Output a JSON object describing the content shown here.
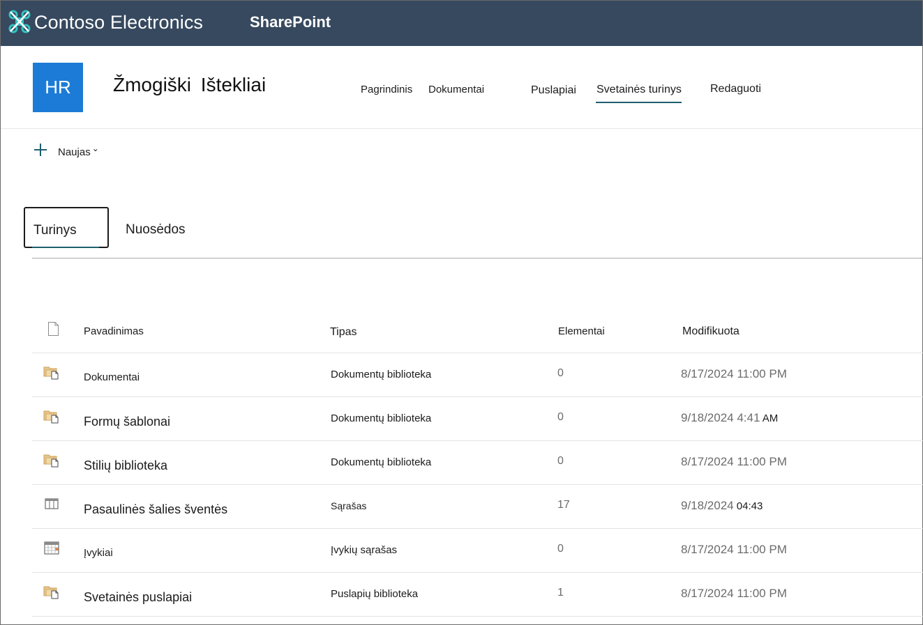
{
  "suite": {
    "brand": "Contoso Electronics",
    "app": "SharePoint",
    "colors": {
      "bar": "#36495f",
      "logo": "#35c1c1"
    }
  },
  "site": {
    "logo_text": "HR",
    "title": "Žmogiški  Ištekliai",
    "logo_color": "#1c7bd6",
    "nav": {
      "home": "Pagrindinis",
      "documents": "Dokumentai",
      "pages": "Puslapiai",
      "site_contents": "Svetainės turinys",
      "edit": "Redaguoti"
    }
  },
  "command_bar": {
    "new_label": "Naujas"
  },
  "tabs": {
    "contents": "Turinys",
    "subsites": "Nuosėdos"
  },
  "table": {
    "headers": {
      "name": "Pavadinimas",
      "type": "Tipas",
      "items": "Elementai",
      "modified": "Modifikuota"
    },
    "rows": [
      {
        "icon": "document-library-icon",
        "name": "Dokumentai",
        "type": "Dokumentų biblioteka",
        "items": "0",
        "modified": "8/17/2024 11:00 PM",
        "modified_suffix": ""
      },
      {
        "icon": "document-library-icon",
        "name": "Formų šablonai",
        "type": "Dokumentų biblioteka",
        "items": "0",
        "modified": "9/18/2024 4:41",
        "modified_suffix": " AM"
      },
      {
        "icon": "document-library-icon",
        "name": "Stilių biblioteka",
        "type": "Dokumentų biblioteka",
        "items": "0",
        "modified": "8/17/2024 11:00 PM",
        "modified_suffix": ""
      },
      {
        "icon": "list-icon",
        "name": "Pasaulinės šalies šventės",
        "type": "Sąrašas",
        "items": "17",
        "modified": "9/18/2024",
        "modified_suffix": " 04:43"
      },
      {
        "icon": "calendar-icon",
        "name": "Įvykiai",
        "type": "Įvykių sąrašas",
        "items": "0",
        "modified": "8/17/2024 11:00 PM",
        "modified_suffix": ""
      },
      {
        "icon": "document-library-icon",
        "name": "Svetainės puslapiai",
        "type": "Puslapių biblioteka",
        "items": "1",
        "modified": "8/17/2024 11:00 PM",
        "modified_suffix": ""
      }
    ]
  }
}
